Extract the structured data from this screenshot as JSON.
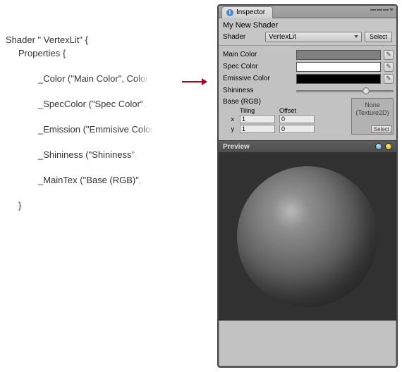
{
  "code": {
    "l1": "Shader \" VertexLit\" {",
    "l2": "Properties {",
    "l3a": "_Color (\"Main Color\", ",
    "l3b": "Color",
    "l4a": "_SpecColor (\"Spec Colo",
    "l4b": "r\",",
    "l5a": "_Emission (\"Emmisive ",
    "l5b": "Color",
    "l6a": "_Shininess (\"Shinines",
    "l6b": "s\",",
    "l7a": "_MainTex (\"Base (RGB)",
    "l7b": "\",",
    "l8": "}"
  },
  "inspector": {
    "tab": "Inspector",
    "material_name": "My New Shader",
    "shader_label": "Shader",
    "shader_value": "VertexLit",
    "select_btn": "Select",
    "props": {
      "main_color": {
        "label": "Main Color",
        "hex": "#808080"
      },
      "spec_color": {
        "label": "Spec Color",
        "hex": "#ffffff"
      },
      "emissive": {
        "label": "Emissive Color",
        "hex": "#000000"
      },
      "shininess": {
        "label": "Shininess"
      }
    },
    "picker_glyph": "✎",
    "tex": {
      "label": "Base (RGB)",
      "tiling_label": "Tiling",
      "offset_label": "Offset",
      "x_label": "x",
      "y_label": "y",
      "tiling_x": "1",
      "tiling_y": "1",
      "offset_x": "0",
      "offset_y": "0",
      "slot_none": "None",
      "slot_type": "(Texture2D)",
      "slot_select": "Select"
    },
    "preview_label": "Preview"
  }
}
